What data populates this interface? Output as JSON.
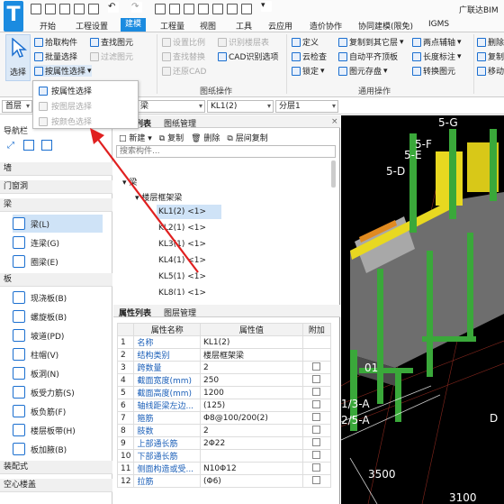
{
  "app": {
    "brand": "广联达BIM"
  },
  "menu": [
    "开始",
    "工程设置",
    "建模",
    "工程量",
    "视图",
    "工具",
    "云应用",
    "造价协作",
    "协同建模(限免)",
    "IGMS"
  ],
  "ribbon": {
    "select": "选择",
    "pick": "拾取构件",
    "batch": "批量选择",
    "by_attr": "按属性选择",
    "find": "查找图元",
    "filter": "过滤图元",
    "set_ratio": "设置比例",
    "recognize_layer": "识别楼层表",
    "find_replace": "查找替换",
    "cad_recognize": "CAD识别选项",
    "restore_cad": "还原CAD",
    "define": "定义",
    "copy_other": "复制到其它层",
    "two_point": "两点辅轴",
    "del_aux": "删除",
    "cloud_check": "云检查",
    "auto_level": "自动平齐顶板",
    "length_mark": "长度标注",
    "copy2": "复制",
    "lock": "锁定",
    "save_elem": "图元存盘",
    "convert": "转换图元",
    "move": "移动",
    "group_drawing": "图纸操作",
    "group_common": "通用操作"
  },
  "dropdown": [
    "按属性选择",
    "按图层选择",
    "按颜色选择"
  ],
  "filterbar": {
    "floor": "首层",
    "category": "梁",
    "component": "KL1(2)",
    "layer": "分层1"
  },
  "nav": {
    "title": "导航栏",
    "sections": [
      "墙",
      "门窗洞",
      "梁",
      "板",
      "装配式",
      "空心楼盖"
    ],
    "beam_items": [
      "梁(L)",
      "连梁(G)",
      "圈梁(E)"
    ],
    "slab_items": [
      "现浇板(B)",
      "螺旋板(B)",
      "坡道(PD)",
      "柱帽(V)",
      "板洞(N)",
      "板受力筋(S)",
      "板负筋(F)",
      "楼层板带(H)",
      "板加腋(B)"
    ]
  },
  "component_list": {
    "tab1": "构件列表",
    "tab2": "图纸管理",
    "new": "新建",
    "copy": "复制",
    "delete": "删除",
    "floor_copy": "层间复制",
    "search_placeholder": "搜索构件...",
    "root": "梁",
    "group": "楼层框架梁",
    "items": [
      "KL1(2) <1>",
      "KL2(1) <1>",
      "KL3(1) <1>",
      "KL4(1) <1>",
      "KL5(1) <1>",
      "KL8(1) <1>"
    ]
  },
  "props": {
    "tab1": "属性列表",
    "tab2": "图层管理",
    "headers": [
      "属性名称",
      "属性值",
      "附加"
    ],
    "rows": [
      {
        "n": "1",
        "name": "名称",
        "value": "KL1(2)"
      },
      {
        "n": "2",
        "name": "结构类别",
        "value": "楼层框架梁"
      },
      {
        "n": "3",
        "name": "跨数量",
        "value": "2"
      },
      {
        "n": "4",
        "name": "截面宽度(mm)",
        "value": "250"
      },
      {
        "n": "5",
        "name": "截面高度(mm)",
        "value": "1200"
      },
      {
        "n": "6",
        "name": "轴线距梁左边...",
        "value": "(125)"
      },
      {
        "n": "7",
        "name": "箍筋",
        "value": "Φ8@100/200(2)"
      },
      {
        "n": "8",
        "name": "肢数",
        "value": "2"
      },
      {
        "n": "9",
        "name": "上部通长筋",
        "value": "2Φ22"
      },
      {
        "n": "10",
        "name": "下部通长筋",
        "value": ""
      },
      {
        "n": "11",
        "name": "侧面构造或受...",
        "value": "N10Φ12"
      },
      {
        "n": "12",
        "name": "拉筋",
        "value": "(Φ6)"
      }
    ]
  },
  "viewport": {
    "labels": [
      "5-G",
      "5-F",
      "5-E",
      "5-D",
      "01",
      "1/3-A",
      "2/5-A",
      "3500",
      "3100",
      "D"
    ]
  },
  "colors": {
    "accent": "#1b8be0",
    "annotation": "#e02020",
    "beam_yellow": "#e8d820",
    "column_green": "#3aa83a",
    "slab_gray": "#6e6e6e",
    "viewport_bg": "#000000"
  }
}
